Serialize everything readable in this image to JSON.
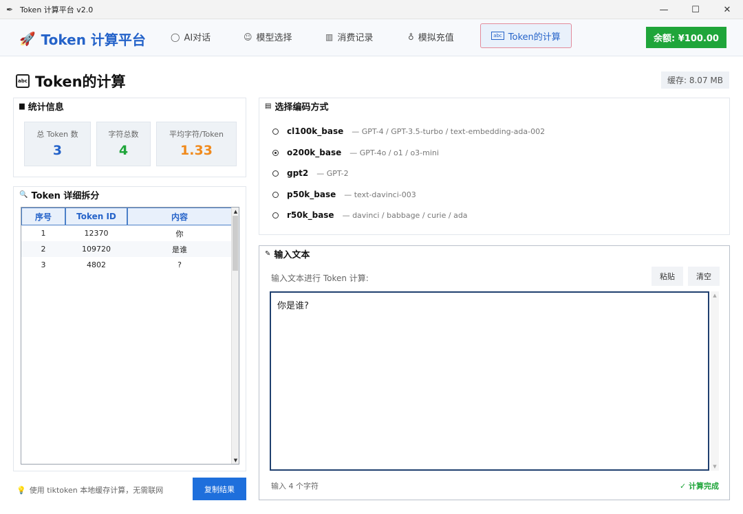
{
  "window": {
    "title": "Token 计算平台 v2.0",
    "icon": "feather-icon",
    "min": "—",
    "max": "☐",
    "close": "✕"
  },
  "nav": {
    "brand": "Token 计算平台",
    "items": [
      {
        "label": "AI对话",
        "icon": "chat-bubble-icon"
      },
      {
        "label": "模型选择",
        "icon": "robot-icon"
      },
      {
        "label": "消费记录",
        "icon": "bar-chart-icon"
      },
      {
        "label": "模拟充值",
        "icon": "money-bag-icon"
      }
    ],
    "active": {
      "label": "Token的计算",
      "icon": "abc-icon"
    },
    "balance": "余额: ¥100.00"
  },
  "page": {
    "title": "Token的计算",
    "cache": "缓存: 8.07 MB"
  },
  "stats": {
    "title": "统计信息",
    "items": [
      {
        "label": "总 Token 数",
        "value": "3",
        "color": "#2563c9"
      },
      {
        "label": "字符总数",
        "value": "4",
        "color": "#1fa53a"
      },
      {
        "label": "平均字符/Token",
        "value": "1.33",
        "color": "#f08a1c"
      }
    ]
  },
  "breakdown": {
    "title": "Token 详细拆分",
    "columns": [
      "序号",
      "Token ID",
      "内容"
    ],
    "rows": [
      [
        "1",
        "12370",
        "你"
      ],
      [
        "2",
        "109720",
        "是谁"
      ],
      [
        "3",
        "4802",
        "?"
      ]
    ]
  },
  "footer_hint": "使用 tiktoken 本地缓存计算，无需联网",
  "copy_button": "复制结果",
  "encoding": {
    "title": "选择编码方式",
    "selected": "o200k_base",
    "options": [
      {
        "name": "cl100k_base",
        "desc": "— GPT-4 / GPT-3.5-turbo / text-embedding-ada-002"
      },
      {
        "name": "o200k_base",
        "desc": "— GPT-4o / o1 / o3-mini"
      },
      {
        "name": "gpt2",
        "desc": "— GPT-2"
      },
      {
        "name": "p50k_base",
        "desc": "— text-davinci-003"
      },
      {
        "name": "r50k_base",
        "desc": "— davinci / babbage / curie / ada"
      }
    ]
  },
  "input": {
    "title": "输入文本",
    "prompt": "输入文本进行 Token 计算:",
    "paste": "粘贴",
    "clear": "清空",
    "value": "你是谁?",
    "char_count": "输入 4 个字符",
    "status": "✓ 计算完成"
  }
}
